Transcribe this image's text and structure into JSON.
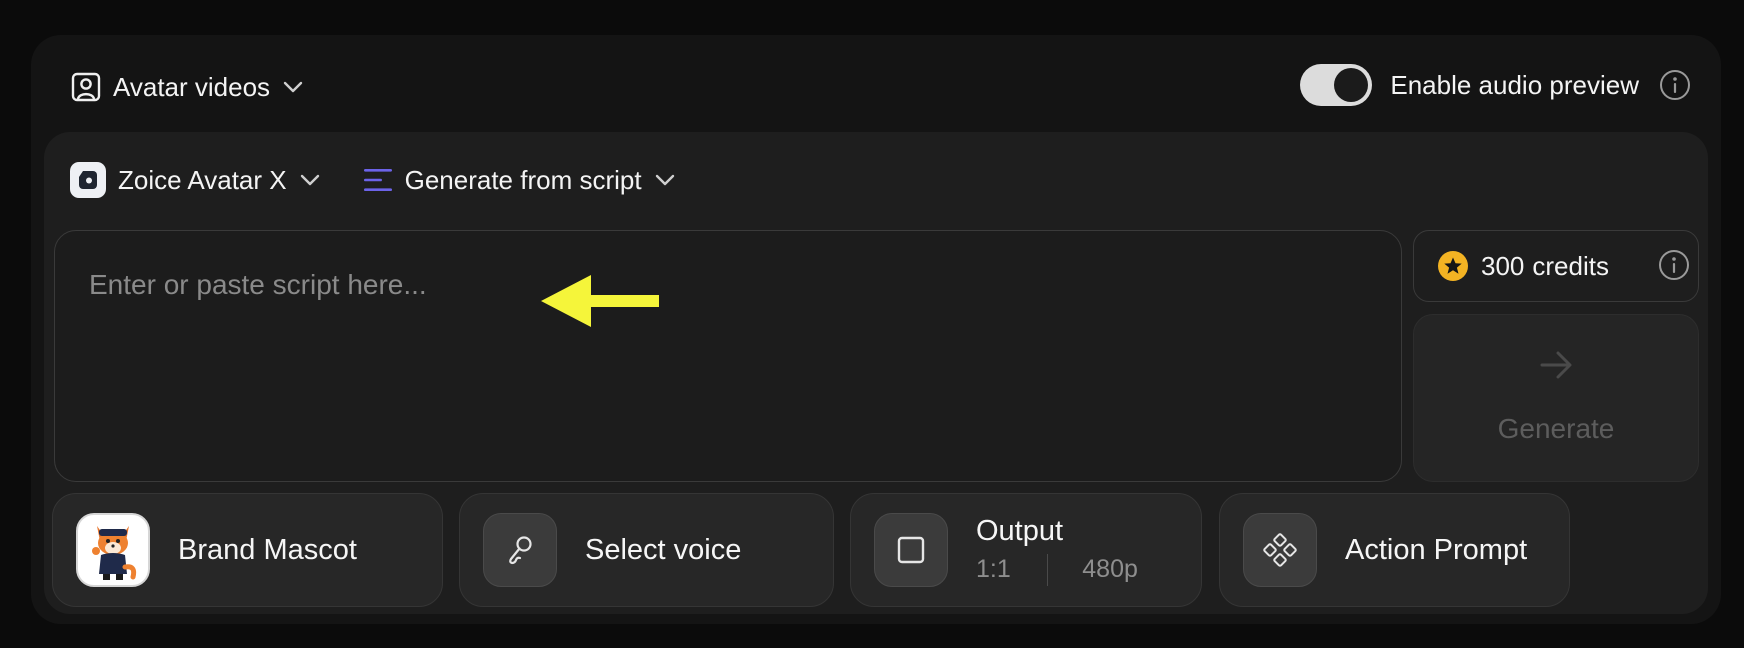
{
  "header": {
    "mode_label": "Avatar videos",
    "audio_preview_label": "Enable audio preview",
    "audio_preview_enabled": true
  },
  "toolbar": {
    "model_label": "Zoice Avatar X",
    "generation_mode_label": "Generate from script"
  },
  "script": {
    "placeholder": "Enter or paste script here...",
    "value": ""
  },
  "credits": {
    "amount": "300",
    "label": "credits"
  },
  "generate": {
    "label": "Generate"
  },
  "options": {
    "avatar": {
      "label": "Brand Mascot"
    },
    "voice": {
      "label": "Select voice"
    },
    "output": {
      "label": "Output",
      "aspect_ratio": "1:1",
      "resolution": "480p"
    },
    "action": {
      "label": "Action Prompt"
    }
  },
  "colors": {
    "accent_toggle": "#dcdcdc",
    "coin": "#f3b323",
    "generate_icon": "#5b5bd6",
    "annotation_arrow": "#f5f53a"
  },
  "icons": {
    "mode": "person-square-icon",
    "model": "model-logo-icon",
    "generation": "lines-icon",
    "voice": "microphone-icon",
    "output": "square-icon",
    "action": "diamond-dots-icon"
  }
}
